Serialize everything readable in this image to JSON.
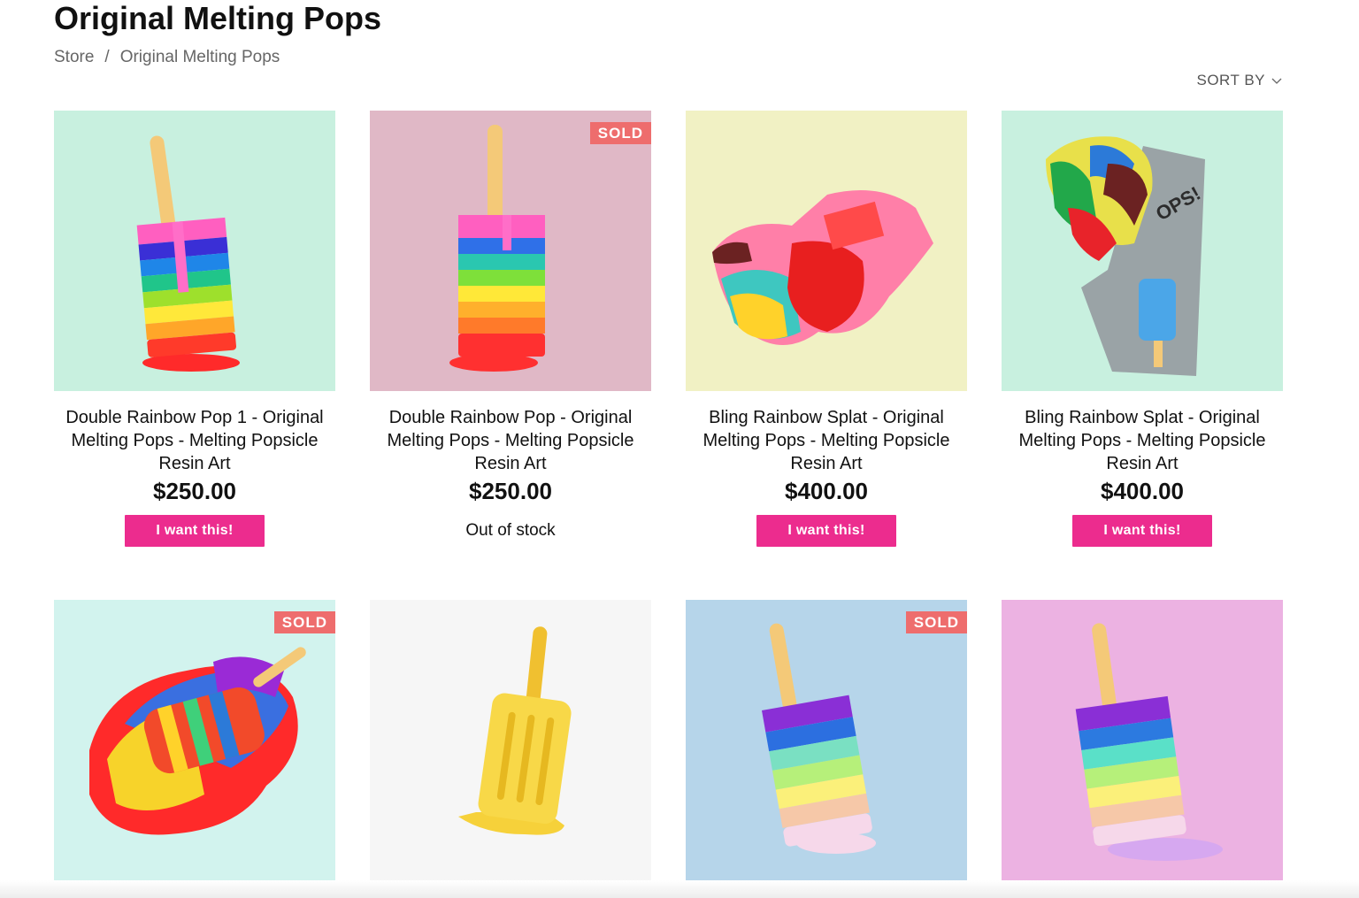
{
  "page": {
    "title": "Original Melting Pops"
  },
  "breadcrumb": {
    "items": [
      "Store",
      "Original Melting Pops"
    ],
    "separator": "/"
  },
  "sort": {
    "label": "SORT BY"
  },
  "products": [
    {
      "title": "Double Rainbow Pop 1 - Original Melting Pops - Melting Popsicle Resin Art",
      "price": "$250.00",
      "action": "I want this!",
      "sold": false,
      "bg": "#c8f0df"
    },
    {
      "title": "Double Rainbow Pop - Original Melting Pops - Melting Popsicle Resin Art",
      "price": "$250.00",
      "stock": "Out of stock",
      "sold": true,
      "badge": "SOLD",
      "bg": "#e0b8c6"
    },
    {
      "title": "Bling Rainbow Splat - Original Melting Pops - Melting Popsicle Resin Art",
      "price": "$400.00",
      "action": "I want this!",
      "sold": false,
      "bg": "#f1f1c4"
    },
    {
      "title": "Bling Rainbow Splat - Original Melting Pops - Melting Popsicle Resin Art",
      "price": "$400.00",
      "action": "I want this!",
      "sold": false,
      "bg": "#c8f0df"
    },
    {
      "sold": true,
      "badge": "SOLD",
      "bg": "#d2f3ee"
    },
    {
      "sold": false,
      "bg": "#f6f6f6"
    },
    {
      "sold": true,
      "badge": "SOLD",
      "bg": "#b6d5ea"
    },
    {
      "sold": false,
      "bg": "#ecb2e2"
    }
  ],
  "colors": {
    "accent": "#ec2c8e",
    "sold_badge": "#ee6d6d"
  }
}
